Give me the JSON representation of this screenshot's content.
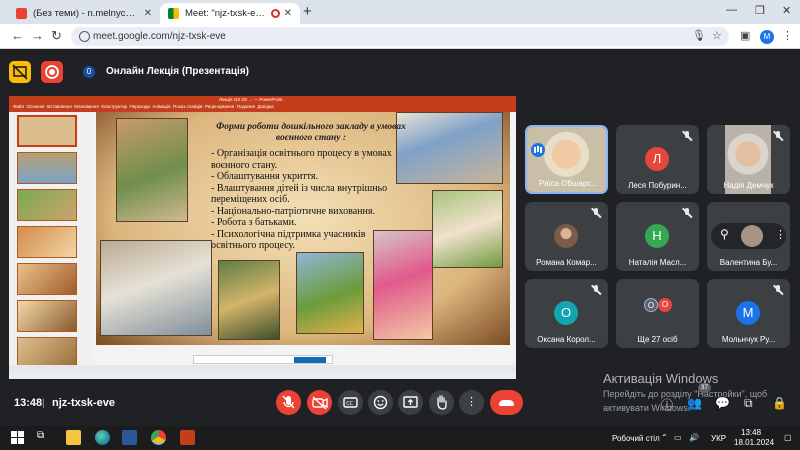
{
  "browser": {
    "tabs": [
      {
        "title": "(Без теми) - n.melnychuk@ippo...",
        "active": false
      },
      {
        "title": "Meet: \"njz-txsk-eve\"",
        "active": true
      }
    ],
    "url": "meet.google.com/njz-txsk-eve",
    "profile_initial": "M"
  },
  "meet": {
    "presenter_count": "0",
    "title": "Онлайн Лекція (Презентація)",
    "time": "13:48",
    "separator": "|",
    "meeting_code": "njz-txsk-eve",
    "participant_badge": "37"
  },
  "presentation": {
    "slide_title": "Форми роботи дошкільного закладу в умовах воєнного стану :",
    "slide_lines": [
      "- Організація   освітнього процесу  в умовах воєнного стану.",
      "- Облаштування укриття.",
      "- Влаштування дітей із числа внутрішньо переміщених осіб.",
      "- Національно-патріотичне виховання.",
      "- Робота з батьками.",
      "- Психологічна підтримка учасників освітнього процесу."
    ]
  },
  "participants": [
    {
      "name": "Раїса Обшарс...",
      "type": "video",
      "speaking": true
    },
    {
      "name": "Леся Побурин...",
      "initial": "Л",
      "color": "#e8453c",
      "muted": true
    },
    {
      "name": "Надія Демчук",
      "type": "video",
      "muted": true
    },
    {
      "name": "Романа Комар...",
      "type": "photo",
      "muted": true
    },
    {
      "name": "Наталія Масл...",
      "initial": "Н",
      "color": "#34a853",
      "muted": true
    },
    {
      "name": "Валентина Бу...",
      "type": "pinned"
    },
    {
      "name": "Оксана Корол...",
      "initial": "О",
      "color": "#12a4af",
      "muted": true
    },
    {
      "name": "Ще 27 осіб",
      "type": "more",
      "mini": [
        "О",
        "О"
      ]
    },
    {
      "name": "Мольнчук Ру...",
      "initial": "М",
      "color": "#1a73e8",
      "muted": true
    }
  ],
  "activation": {
    "title": "Активація Windows",
    "line1": "Перейдіть до розділу \"Настройки\", щоб",
    "line2": "активувати Windows."
  },
  "taskbar": {
    "workspace_label": "Робочий стіл",
    "language": "УКР",
    "clock_time": "13:48",
    "clock_date": "18.01.2024"
  },
  "colors": {
    "meet_bg": "#202124",
    "tile_bg": "#3c4043",
    "hangup_red": "#ea4335",
    "accent_blue": "#8ab4f8",
    "ppt_red": "#c43e1c"
  }
}
